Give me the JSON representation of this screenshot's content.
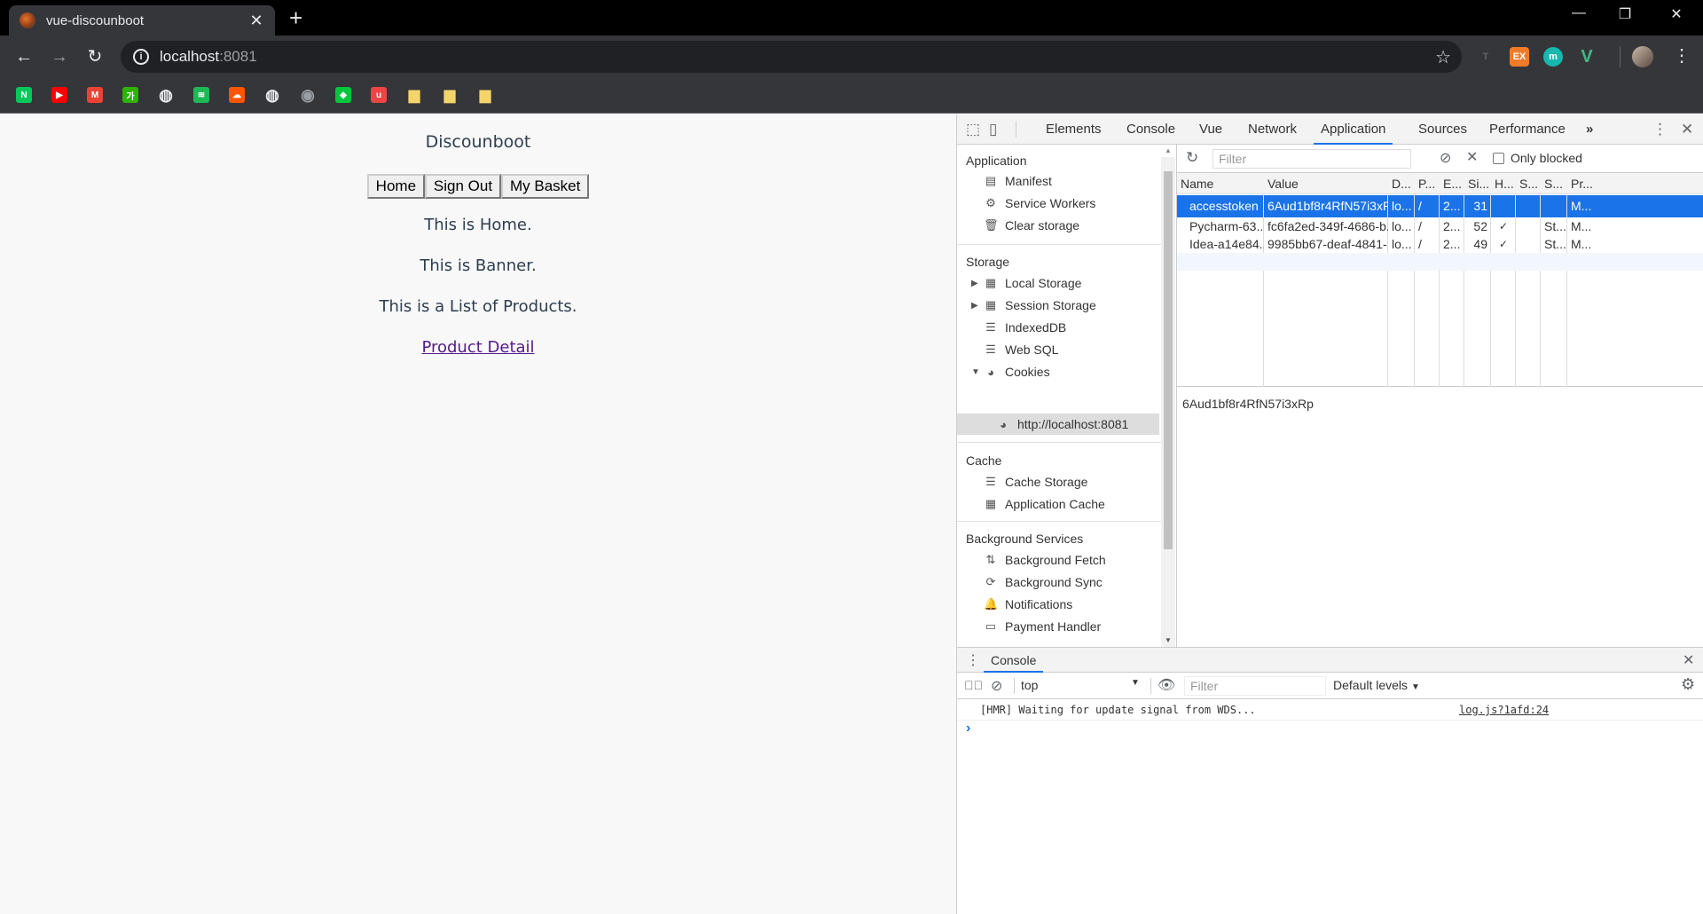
{
  "browser": {
    "tab_title": "vue-discounboot",
    "url_host": "localhost",
    "url_port": ":8081",
    "extensions": [
      {
        "name": "T",
        "color": "#5f6368"
      },
      {
        "name": "EX",
        "color": "#f07c2a"
      },
      {
        "name": "m",
        "color": "#18b8b0"
      },
      {
        "name": "V",
        "color": "#41b883"
      }
    ],
    "bookmarks": [
      {
        "icon": "N",
        "color": "#03c75a"
      },
      {
        "icon": "▶",
        "color": "#ff0000"
      },
      {
        "icon": "M",
        "color": "#ea4335"
      },
      {
        "icon": "가",
        "color": "#2db400"
      },
      {
        "icon": "◍",
        "color": "#e8eaed"
      },
      {
        "icon": "≋",
        "color": "#1db954"
      },
      {
        "icon": "☁",
        "color": "#ff5500"
      },
      {
        "icon": "◍",
        "color": "#e8eaed"
      },
      {
        "icon": "◉",
        "color": "#24292e"
      },
      {
        "icon": "◆",
        "color": "#00c73c"
      },
      {
        "icon": "u",
        "color": "#e44"
      },
      {
        "icon": "▆",
        "color": "#f4d56b"
      },
      {
        "icon": "▆",
        "color": "#f4d56b"
      },
      {
        "icon": "▆",
        "color": "#f4d56b"
      }
    ]
  },
  "page": {
    "heading": "Discounboot",
    "nav": [
      "Home",
      "Sign Out",
      "My Basket"
    ],
    "home_text": "This is Home.",
    "banner_text": "This is Banner.",
    "list_text": "This is a List of Products.",
    "detail_link": "Product Detail"
  },
  "devtools": {
    "tabs": [
      "Elements",
      "Console",
      "Vue",
      "Network",
      "Application",
      "Sources",
      "Performance"
    ],
    "active_tab": "Application",
    "more": "»",
    "sidebar": {
      "application_title": "Application",
      "application_items": [
        "Manifest",
        "Service Workers",
        "Clear storage"
      ],
      "storage_title": "Storage",
      "storage_items": [
        "Local Storage",
        "Session Storage",
        "IndexedDB",
        "Web SQL",
        "Cookies"
      ],
      "cookie_origin": "http://localhost:8081",
      "cache_title": "Cache",
      "cache_items": [
        "Cache Storage",
        "Application Cache"
      ],
      "bg_title": "Background Services",
      "bg_items": [
        "Background Fetch",
        "Background Sync",
        "Notifications",
        "Payment Handler"
      ]
    },
    "cookies": {
      "filter_placeholder": "Filter",
      "only_blocked": "Only blocked",
      "columns": [
        "Name",
        "Value",
        "D...",
        "P...",
        "E...",
        "Si...",
        "H...",
        "S...",
        "S...",
        "Pr..."
      ],
      "rows": [
        [
          "accesstoken",
          "6Aud1bf8r4RfN57i3xRp",
          "lo...",
          "/",
          "2...",
          "31",
          "",
          "",
          "",
          "M..."
        ],
        [
          "Pycharm-63...",
          "fc6fa2ed-349f-4686-b...",
          "lo...",
          "/",
          "2...",
          "52",
          "✓",
          "",
          "St...",
          "M..."
        ],
        [
          "Idea-a14e84...",
          "9985bb67-deaf-4841-...",
          "lo...",
          "/",
          "2...",
          "49",
          "✓",
          "",
          "St...",
          "M..."
        ]
      ],
      "selected_value": "6Aud1bf8r4RfN57i3xRp"
    },
    "console": {
      "drawer_title": "Console",
      "context": "top",
      "filter_placeholder": "Filter",
      "levels": "Default levels",
      "message": "[HMR] Waiting for update signal from WDS...",
      "source": "log.js?1afd:24",
      "prompt": "›"
    }
  }
}
